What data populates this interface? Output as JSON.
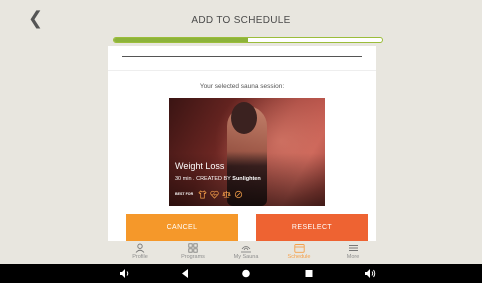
{
  "header": {
    "title": "ADD TO SCHEDULE",
    "back_icon": "chevron-left-icon"
  },
  "progress": {
    "fraction": 0.5,
    "fill_color": "#8db33a",
    "border_color": "#9bbd3a"
  },
  "card": {
    "selected_label": "Your selected sauna session:",
    "session": {
      "name": "Weight Loss",
      "duration": "30 min",
      "created_by_prefix": "CREATED BY",
      "creator": "Sunlighten",
      "best_for_label": "BEST FOR",
      "best_for_icons": [
        "shirt-icon",
        "heart-pulse-icon",
        "weight-scale-icon",
        "candle-icon"
      ]
    }
  },
  "buttons": {
    "cancel": "CANCEL",
    "reselect": "RESELECT",
    "cancel_color": "#f5982a",
    "reselect_color": "#ee6332"
  },
  "tabs": [
    {
      "label": "Profile",
      "icon": "person-icon",
      "active": false
    },
    {
      "label": "Programs",
      "icon": "grid-icon",
      "active": false
    },
    {
      "label": "My Sauna",
      "icon": "sauna-icon",
      "active": false
    },
    {
      "label": "Schedule",
      "icon": "calendar-icon",
      "active": true
    },
    {
      "label": "More",
      "icon": "menu-icon",
      "active": false
    }
  ],
  "tab_active_color": "#f5a04a",
  "system_nav": [
    "volume-down-icon",
    "back-triangle-icon",
    "home-circle-icon",
    "recents-square-icon",
    "volume-up-icon"
  ]
}
